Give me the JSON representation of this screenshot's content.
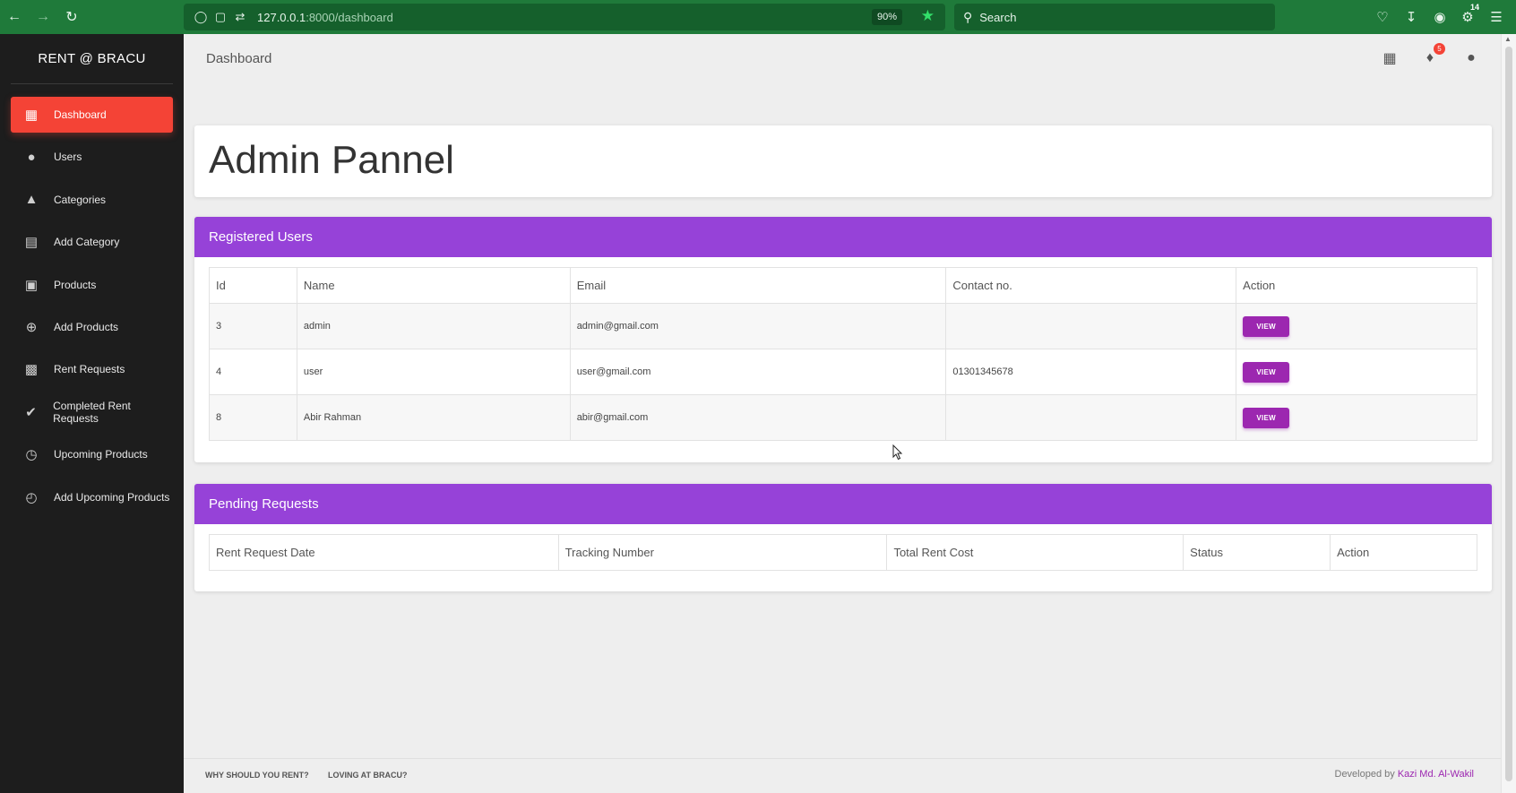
{
  "browser": {
    "back_icon": "arrow-left-icon",
    "url_host": "127.0.0.1",
    "url_path": ":8000/dashboard",
    "zoom": "90%",
    "search_placeholder": "Search",
    "extension_count": "14"
  },
  "sidebar": {
    "brand": "RENT @ BRACU",
    "items": [
      {
        "label": "Dashboard",
        "icon": "dashboard-icon",
        "active": true
      },
      {
        "label": "Users",
        "icon": "person-icon"
      },
      {
        "label": "Categories",
        "icon": "category-icon"
      },
      {
        "label": "Add Category",
        "icon": "folder-add-icon"
      },
      {
        "label": "Products",
        "icon": "store-icon"
      },
      {
        "label": "Add Products",
        "icon": "add-circle-icon"
      },
      {
        "label": "Rent Requests",
        "icon": "clipboard-icon"
      },
      {
        "label": "Completed Rent Requests",
        "icon": "check-circle-icon"
      },
      {
        "label": "Upcoming Products",
        "icon": "alarm-icon"
      },
      {
        "label": "Add Upcoming Products",
        "icon": "alarm-add-icon"
      }
    ]
  },
  "header": {
    "title": "Dashboard",
    "notification_count": "5"
  },
  "main": {
    "heading": "Admin Pannel",
    "registered_users": {
      "title": "Registered Users",
      "columns": [
        "Id",
        "Name",
        "Email",
        "Contact no.",
        "Action"
      ],
      "rows": [
        {
          "id": "3",
          "name": "admin",
          "email": "admin@gmail.com",
          "contact": "",
          "action": "VIEW"
        },
        {
          "id": "4",
          "name": "user",
          "email": "user@gmail.com",
          "contact": "01301345678",
          "action": "VIEW"
        },
        {
          "id": "8",
          "name": "Abir Rahman",
          "email": "abir@gmail.com",
          "contact": "",
          "action": "VIEW"
        }
      ]
    },
    "pending_requests": {
      "title": "Pending Requests",
      "columns": [
        "Rent Request Date",
        "Tracking Number",
        "Total Rent Cost",
        "Status",
        "Action"
      ]
    }
  },
  "footer": {
    "links": [
      "WHY SHOULD YOU RENT?",
      "LOVING AT BRACU?"
    ],
    "credit_prefix": "Developed by ",
    "credit_author": "Kazi Md. Al-Wakil"
  },
  "colors": {
    "browser_bar": "#1f7a3a",
    "sidebar_bg": "#1d1d1d",
    "active_item": "#f44336",
    "card_header": "#9642d8",
    "view_button": "#9c27b0"
  }
}
